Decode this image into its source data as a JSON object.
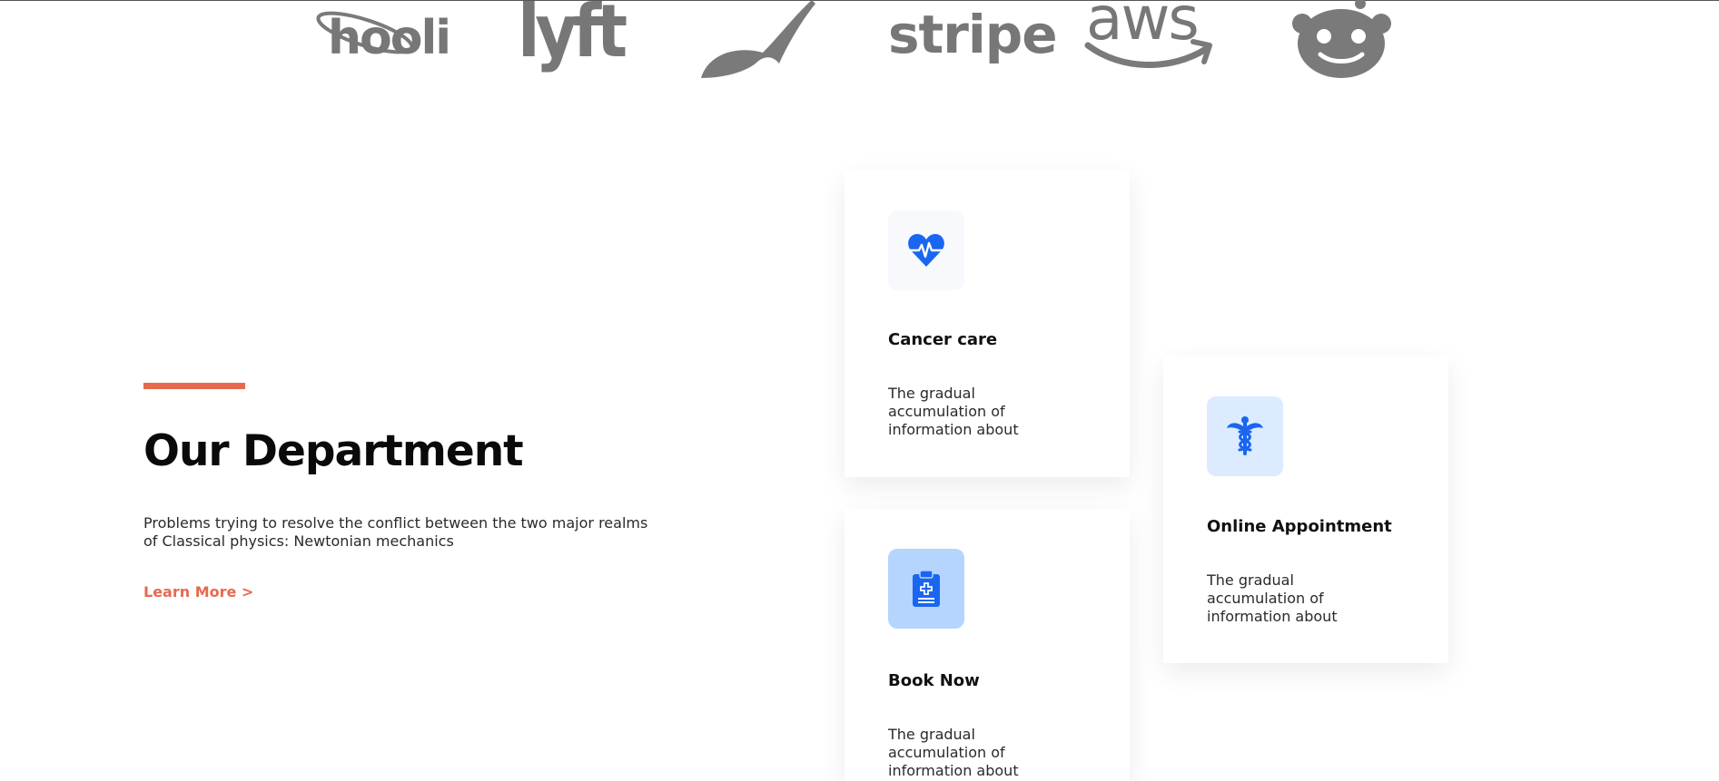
{
  "logos": {
    "hooli": "hooli",
    "lyft": "lyft",
    "robinhood": "robinhood-feather-icon",
    "stripe": "stripe",
    "aws": "aws",
    "reddit": "reddit-alien-icon"
  },
  "department": {
    "title": "Our Department",
    "description": "Problems trying to resolve the conflict between the two major realms of Classical physics: Newtonian mechanics",
    "learn_more": "Learn More >"
  },
  "cards": [
    {
      "icon": "heart-pulse-icon",
      "title": "Cancer care",
      "text": "The gradual accumulation of information about"
    },
    {
      "icon": "caduceus-icon",
      "title": "Online Appointment",
      "text": "The gradual accumulation of information about"
    },
    {
      "icon": "clipboard-medical-icon",
      "title": "Book Now",
      "text": "The gradual accumulation of information about"
    }
  ],
  "colors": {
    "accent": "#e8694f",
    "icon_blue": "#1a66f0",
    "logo_gray": "#7a7a7a"
  }
}
